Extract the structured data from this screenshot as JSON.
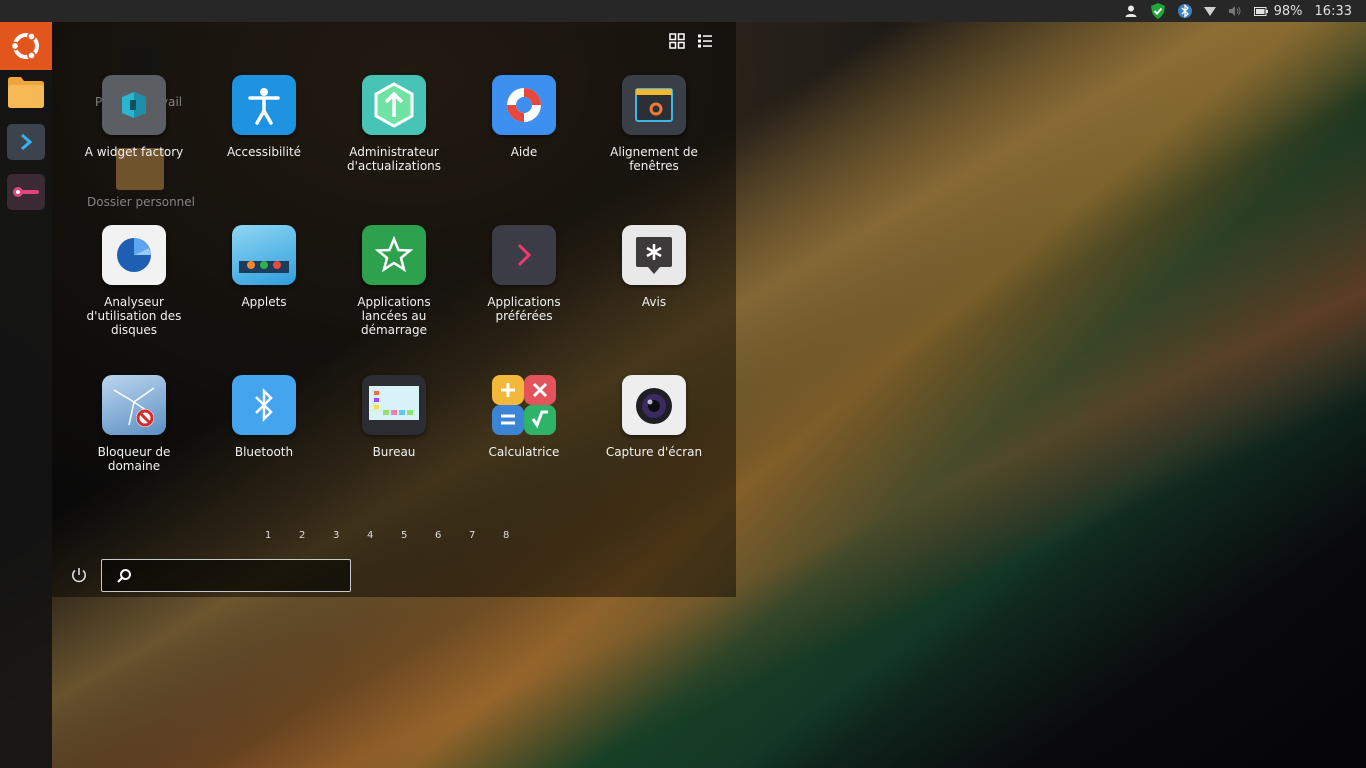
{
  "topbar": {
    "battery": "98%",
    "clock": "16:33",
    "tray_icons": [
      "user-icon",
      "shield-check-icon",
      "bluetooth-icon",
      "wifi-icon",
      "volume-icon",
      "battery-icon"
    ]
  },
  "launcher": {
    "items": [
      {
        "name": "ubuntu-home",
        "color": "#e2561e"
      },
      {
        "name": "files",
        "color": "#f3a94a"
      },
      {
        "name": "terminal",
        "color": "#3a3f47"
      },
      {
        "name": "app-toggle",
        "color": "#3b2a35"
      }
    ]
  },
  "desktop_ghost": {
    "label1_left": "P",
    "label1_right": "vail",
    "label2": "Dossier personnel"
  },
  "apps": [
    {
      "label": "A widget factory",
      "icon": "widget-factory-icon"
    },
    {
      "label": "Accessibilité",
      "icon": "accessibility-icon"
    },
    {
      "label": "Administrateur d'actualizations",
      "icon": "update-manager-icon"
    },
    {
      "label": "Aide",
      "icon": "help-lifebuoy-icon"
    },
    {
      "label": "Alignement de fenêtres",
      "icon": "window-align-icon"
    },
    {
      "label": "Analyseur d'utilisation des disques",
      "icon": "disk-usage-icon"
    },
    {
      "label": "Applets",
      "icon": "applets-icon"
    },
    {
      "label": "Applications lancées au démarrage",
      "icon": "startup-apps-icon"
    },
    {
      "label": "Applications préférées",
      "icon": "preferred-apps-icon"
    },
    {
      "label": "Avis",
      "icon": "notices-icon"
    },
    {
      "label": "Bloqueur de domaine",
      "icon": "domain-blocker-icon"
    },
    {
      "label": "Bluetooth",
      "icon": "bluetooth-app-icon"
    },
    {
      "label": "Bureau",
      "icon": "desktop-app-icon"
    },
    {
      "label": "Calculatrice",
      "icon": "calculator-icon"
    },
    {
      "label": "Capture d'écran",
      "icon": "screenshot-camera-icon"
    }
  ],
  "pager": [
    "1",
    "2",
    "3",
    "4",
    "5",
    "6",
    "7",
    "8"
  ],
  "search": {
    "value": "",
    "placeholder": ""
  }
}
